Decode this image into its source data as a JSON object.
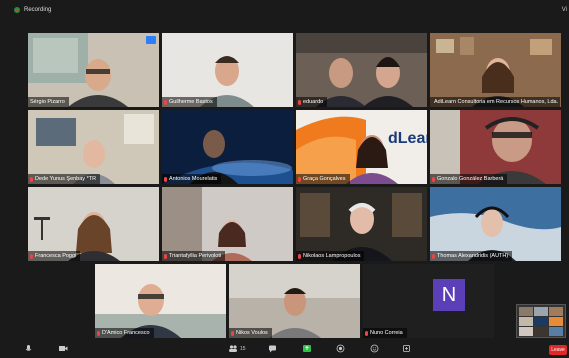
{
  "window": {
    "recording_label": "Recording",
    "view_label": "Vi"
  },
  "participants": [
    {
      "name": "Sérgio Pizarro"
    },
    {
      "name": "Guilherme Bastos"
    },
    {
      "name": "eduardo"
    },
    {
      "name": "AdiLearn Consultoria em Recursos Humanos, Lda."
    },
    {
      "name": "Dede Yunus Şenbay *TR"
    },
    {
      "name": "Antonios Mourelatis"
    },
    {
      "name": "Graça Gonçalves"
    },
    {
      "name": "Gonzalo González Barberá"
    },
    {
      "name": "Francesca Poggi"
    },
    {
      "name": "Triantafyllia Perivoloti"
    },
    {
      "name": "Nikolaos Lampropoulos"
    },
    {
      "name": "Thomas Alexandridis (AUTH)"
    },
    {
      "name": "D'Amico Francesco"
    },
    {
      "name": "Nikos Voulos"
    },
    {
      "name": "Nuno Correia",
      "initial": "N"
    }
  ],
  "banner_text": "dLear",
  "toolbar": {
    "participants_count": "15",
    "leave_label": "Leave"
  },
  "colors": {
    "active_speaker": "#3ec24a",
    "avatar_bg": "#5b3fb8",
    "leave_bg": "#e02828",
    "recording": "#2d8c3c"
  },
  "icons": [
    "mic-icon",
    "video-icon",
    "participants-icon",
    "chat-icon",
    "share-screen-icon",
    "record-icon",
    "reactions-icon",
    "apps-icon"
  ]
}
